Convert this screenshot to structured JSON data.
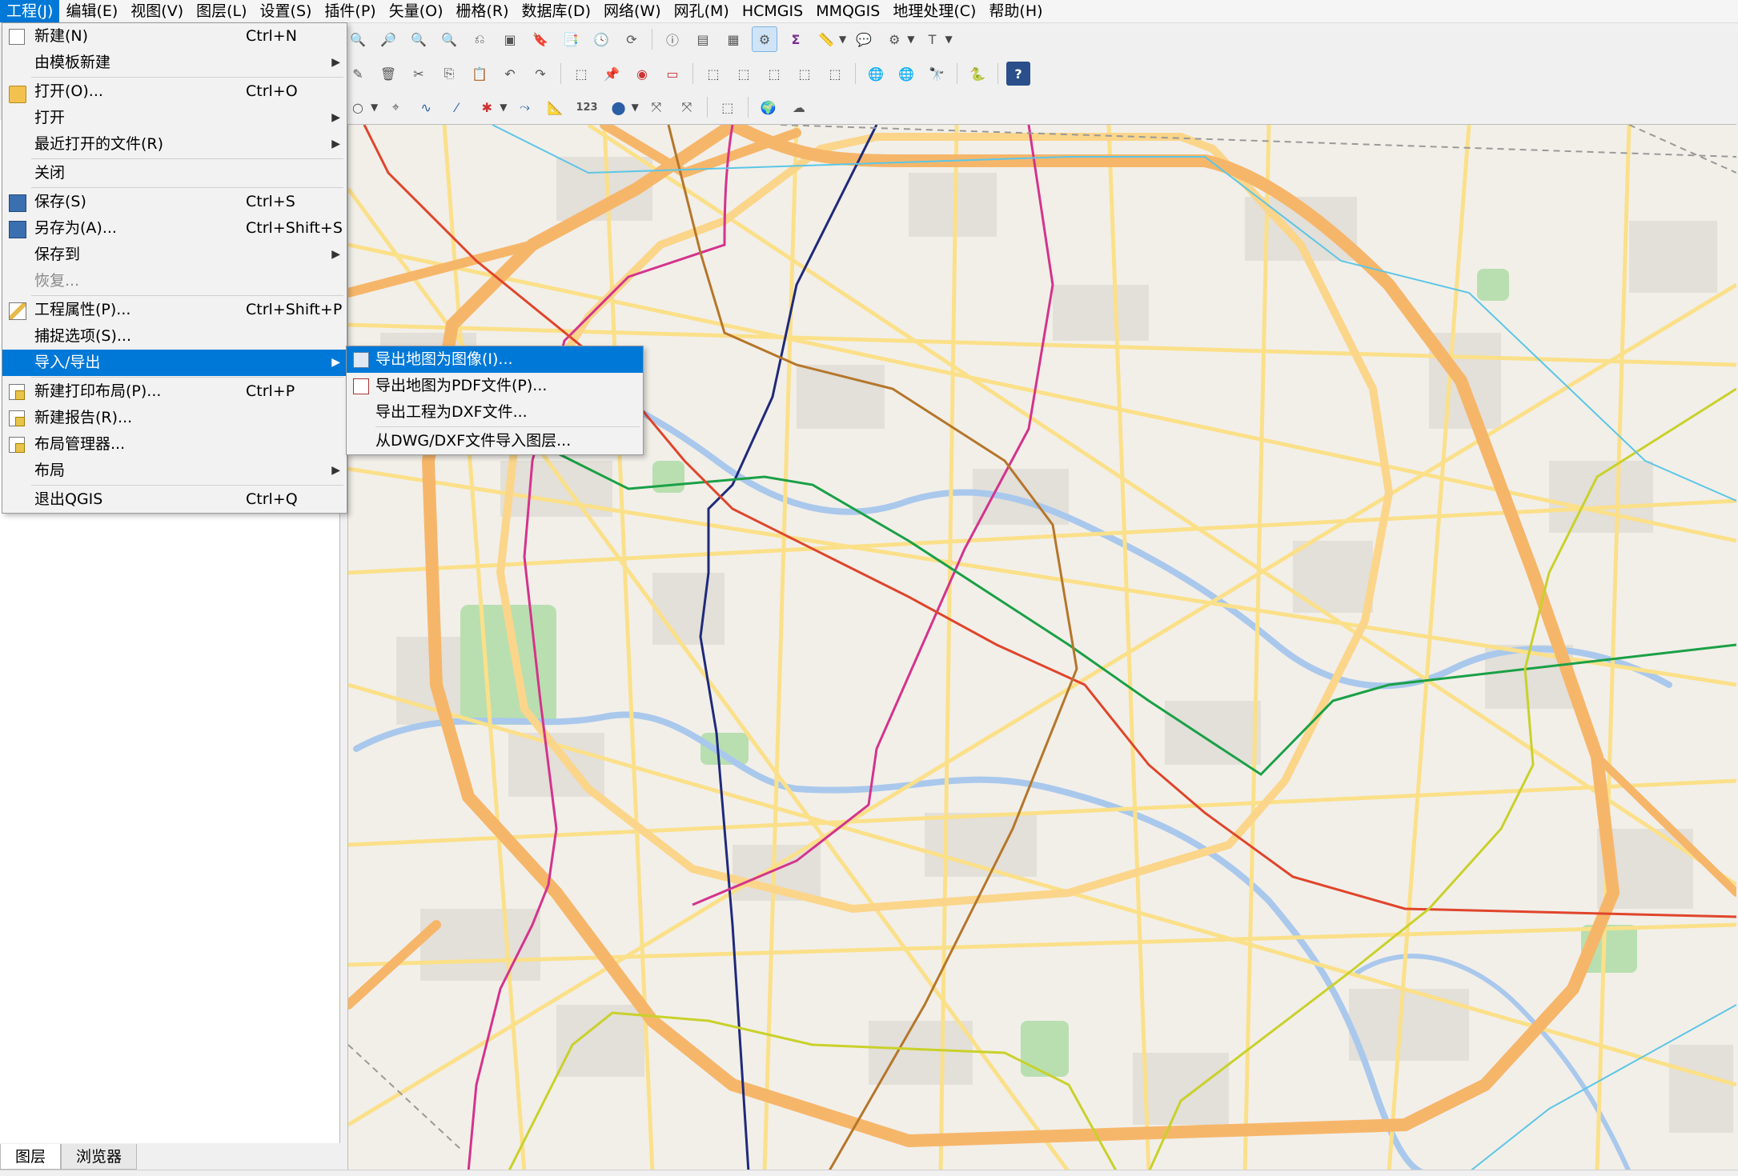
{
  "menubar": {
    "items": [
      "工程(J)",
      "编辑(E)",
      "视图(V)",
      "图层(L)",
      "设置(S)",
      "插件(P)",
      "矢量(O)",
      "栅格(R)",
      "数据库(D)",
      "网络(W)",
      "网孔(M)",
      "HCMGIS",
      "MMQGIS",
      "地理处理(C)",
      "帮助(H)"
    ]
  },
  "project_menu": {
    "items": [
      {
        "label": "新建(N)",
        "shortcut": "Ctrl+N",
        "icon": "new-document-icon"
      },
      {
        "label": "由模板新建",
        "submenu": true
      },
      {
        "label": "打开(O)...",
        "shortcut": "Ctrl+O",
        "icon": "open-folder-icon"
      },
      {
        "label": "打开",
        "submenu": true
      },
      {
        "label": "最近打开的文件(R)",
        "submenu": true
      },
      {
        "label": "关闭"
      },
      {
        "label": "保存(S)",
        "shortcut": "Ctrl+S",
        "icon": "save-icon"
      },
      {
        "label": "另存为(A)...",
        "shortcut": "Ctrl+Shift+S",
        "icon": "save-as-icon"
      },
      {
        "label": "保存到",
        "submenu": true
      },
      {
        "label": "恢复...",
        "disabled": true
      },
      {
        "label": "工程属性(P)...",
        "shortcut": "Ctrl+Shift+P",
        "icon": "project-properties-icon"
      },
      {
        "label": "捕捉选项(S)..."
      },
      {
        "label": "导入/导出",
        "submenu": true,
        "highlighted": true
      },
      {
        "label": "新建打印布局(P)...",
        "shortcut": "Ctrl+P",
        "icon": "new-print-layout-icon"
      },
      {
        "label": "新建报告(R)...",
        "icon": "new-report-icon"
      },
      {
        "label": "布局管理器...",
        "icon": "layout-manager-icon"
      },
      {
        "label": "布局",
        "submenu": true
      },
      {
        "label": "退出QGIS",
        "shortcut": "Ctrl+Q"
      }
    ]
  },
  "import_export_submenu": {
    "items": [
      {
        "label": "导出地图为图像(I)...",
        "icon": "export-image-icon"
      },
      {
        "label": "导出地图为PDF文件(P)...",
        "icon": "export-pdf-icon"
      },
      {
        "label": "导出工程为DXF文件..."
      },
      {
        "label": "从DWG/DXF文件导入图层..."
      }
    ]
  },
  "toolbar_row3": {
    "label_123": "123"
  },
  "panel_tabs": [
    "图层",
    "浏览器"
  ],
  "colors": {
    "menu_highlight": "#0078d7",
    "map_background": "#f2efe9",
    "ring_road": "#f6b66a",
    "street": "#fbe08a",
    "water": "#a9c8ec",
    "park": "#b9dfb0",
    "metro_blue": "#1f2a7a",
    "metro_magenta": "#d4338c",
    "metro_red": "#e0452b",
    "metro_green": "#1aa046",
    "metro_brown": "#b5762a",
    "metro_yellow": "#c9d12a",
    "metro_cyan": "#5cc6e6"
  }
}
